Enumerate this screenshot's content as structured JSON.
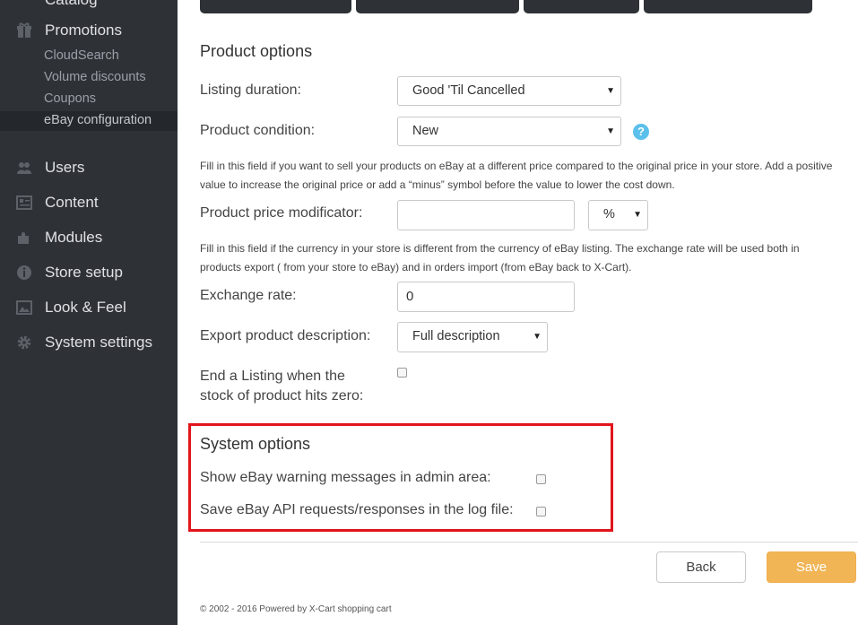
{
  "sidebar": {
    "top_label": "Catalog",
    "promotions": {
      "label": "Promotions",
      "icon": "gift-icon"
    },
    "sub_items": [
      {
        "label": "CloudSearch"
      },
      {
        "label": "Volume discounts"
      },
      {
        "label": "Coupons"
      },
      {
        "label": "eBay configuration",
        "active": true
      }
    ],
    "items": [
      {
        "label": "Users",
        "icon": "users-icon"
      },
      {
        "label": "Content",
        "icon": "content-icon"
      },
      {
        "label": "Modules",
        "icon": "puzzle-icon"
      },
      {
        "label": "Store setup",
        "icon": "info-icon"
      },
      {
        "label": "Look & Feel",
        "icon": "image-icon"
      },
      {
        "label": "System settings",
        "icon": "gear-icon"
      }
    ]
  },
  "product_options": {
    "title": "Product options",
    "listing_duration": {
      "label": "Listing duration:",
      "value": "Good 'Til Cancelled"
    },
    "product_condition": {
      "label": "Product condition:",
      "value": "New",
      "help_icon": "?"
    },
    "price_help": "Fill in this field if you want to sell your products on eBay at a different price compared to the original price in your store. Add a positive value to increase the original price or add a “minus” symbol before the value to lower the cost down.",
    "price_modificator": {
      "label": "Product price modificator:",
      "value": "",
      "unit": "%"
    },
    "currency_help": "Fill in this field if the currency in your store is different from the currency of eBay listing. The exchange rate will be used both in products export ( from your store to eBay) and in orders import (from eBay back to X-Cart).",
    "exchange_rate": {
      "label": "Exchange rate:",
      "value": "0"
    },
    "export_description": {
      "label": "Export product description:",
      "value": "Full description"
    },
    "end_listing": {
      "label_line1": "End a Listing when the",
      "label_line2": "stock of product hits zero:",
      "checked": false
    }
  },
  "system_options": {
    "title": "System options",
    "show_warnings": {
      "label": "Show eBay warning messages in admin area:",
      "checked": false
    },
    "save_api_log": {
      "label": "Save eBay API requests/responses in the log file:",
      "checked": false
    }
  },
  "buttons": {
    "back": "Back",
    "save": "Save"
  },
  "footer": "© 2002 - 2016 Powered by X-Cart shopping cart",
  "colors": {
    "sidebar_bg": "#2e3136",
    "save_button": "#f1b556",
    "highlight": "#e2141b",
    "help_icon": "#5bc0eb"
  }
}
